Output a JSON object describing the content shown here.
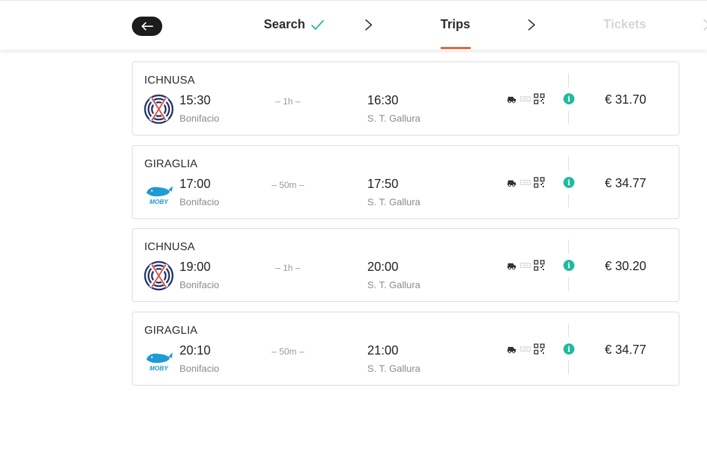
{
  "header": {
    "steps": [
      "Search",
      "Trips",
      "Tickets"
    ],
    "accent_color": "#e8602c",
    "check_color": "#1ebb9c"
  },
  "trips": [
    {
      "company": "ICHNUSA",
      "logo": "ichnusa-logo",
      "dep_time": "15:30",
      "dep_place": "Bonifacio",
      "duration": "– 1h –",
      "arr_time": "16:30",
      "arr_place": "S. T. Gallura",
      "price": "€ 31.70"
    },
    {
      "company": "GIRAGLIA",
      "logo": "moby-whale-logo",
      "dep_time": "17:00",
      "dep_place": "Bonifacio",
      "duration": "– 50m –",
      "arr_time": "17:50",
      "arr_place": "S. T. Gallura",
      "price": "€ 34.77"
    },
    {
      "company": "ICHNUSA",
      "logo": "ichnusa-logo",
      "dep_time": "19:00",
      "dep_place": "Bonifacio",
      "duration": "– 1h –",
      "arr_time": "20:00",
      "arr_place": "S. T. Gallura",
      "price": "€ 30.20"
    },
    {
      "company": "GIRAGLIA",
      "logo": "moby-whale-logo",
      "dep_time": "20:10",
      "dep_place": "Bonifacio",
      "duration": "– 50m –",
      "arr_time": "21:00",
      "arr_place": "S. T. Gallura",
      "price": "€ 34.77"
    }
  ],
  "amenity_icons": [
    "car-icon",
    "ticket-icon",
    "qr-code-icon"
  ],
  "info_icon": "info-icon",
  "info_color": "#1ebb9c"
}
